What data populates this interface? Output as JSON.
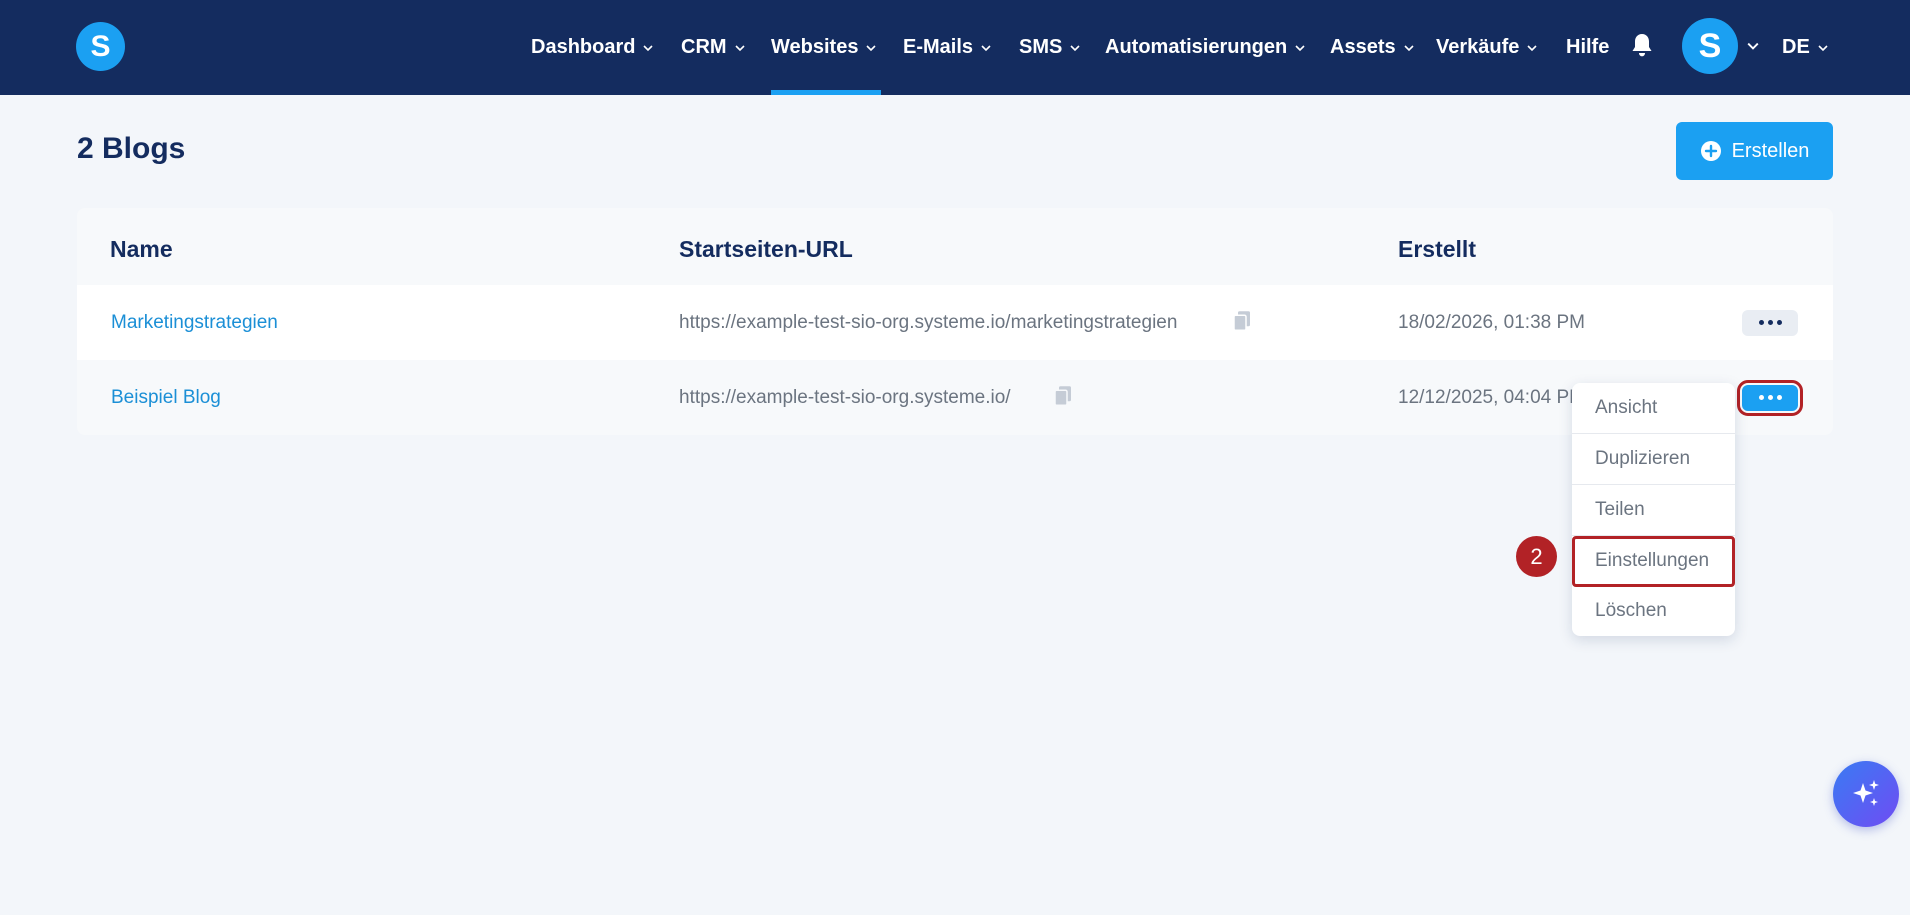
{
  "header": {
    "logo_letter": "S",
    "nav": [
      {
        "label": "Dashboard",
        "has_chevron": true
      },
      {
        "label": "CRM",
        "has_chevron": true
      },
      {
        "label": "Websites",
        "has_chevron": true,
        "active": true
      },
      {
        "label": "E-Mails",
        "has_chevron": true
      },
      {
        "label": "SMS",
        "has_chevron": true
      },
      {
        "label": "Automatisierungen",
        "has_chevron": true
      },
      {
        "label": "Assets",
        "has_chevron": true
      },
      {
        "label": "Verkäufe",
        "has_chevron": true
      },
      {
        "label": "Hilfe",
        "has_chevron": false
      }
    ],
    "avatar_letter": "S",
    "language": "DE"
  },
  "page": {
    "title": "2 Blogs",
    "create_label": "Erstellen"
  },
  "table": {
    "columns": [
      "Name",
      "Startseiten-URL",
      "Erstellt"
    ],
    "rows": [
      {
        "name": "Marketingstrategien",
        "url": "https://example-test-sio-org.systeme.io/marketingstrategien",
        "created": "18/02/2026, 01:38 PM"
      },
      {
        "name": "Beispiel Blog",
        "url": "https://example-test-sio-org.systeme.io/",
        "created": "12/12/2025, 04:04 PM"
      }
    ]
  },
  "menu": {
    "items": [
      "Ansicht",
      "Duplizieren",
      "Teilen",
      "Einstellungen",
      "Löschen"
    ],
    "highlighted": "Einstellungen"
  },
  "annotation": {
    "step": "2"
  },
  "colors": {
    "nav_bg": "#142c5f",
    "accent": "#1ba0f2",
    "link": "#1b8fd6",
    "highlight": "#b22226",
    "page_bg": "#f3f6fa"
  },
  "icons": [
    "chevron-down-icon",
    "bell-icon",
    "plus-circle-icon",
    "copy-icon",
    "more-dots-icon",
    "sparkle-icon"
  ]
}
